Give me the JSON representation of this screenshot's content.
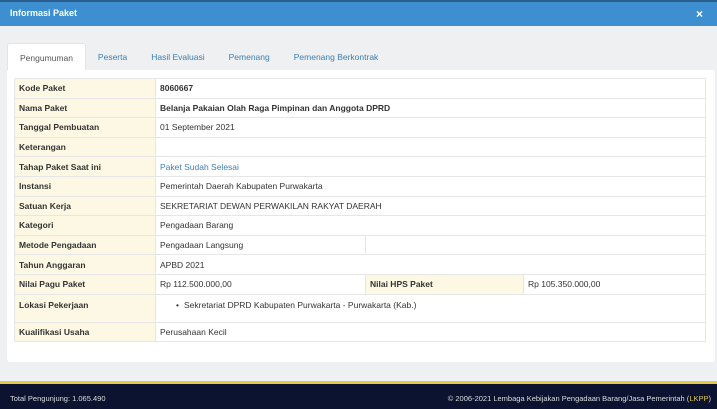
{
  "header": {
    "title": "Informasi Paket",
    "close": "×"
  },
  "tabs": [
    "Pengumuman",
    "Peserta",
    "Hasil Evaluasi",
    "Pemenang",
    "Pemenang Berkontrak"
  ],
  "rows": {
    "kode": {
      "label": "Kode Paket",
      "value": "8060667"
    },
    "nama": {
      "label": "Nama Paket",
      "value": "Belanja Pakaian Olah Raga Pimpinan dan Anggota DPRD"
    },
    "tanggal": {
      "label": "Tanggal Pembuatan",
      "value": "01 September 2021"
    },
    "keterangan": {
      "label": "Keterangan",
      "value": ""
    },
    "tahap": {
      "label": "Tahap Paket Saat ini",
      "value": "Paket Sudah Selesai"
    },
    "instansi": {
      "label": "Instansi",
      "value": "Pemerintah Daerah Kabupaten Purwakarta"
    },
    "satuan": {
      "label": "Satuan Kerja",
      "value": "SEKRETARIAT DEWAN PERWAKILAN RAKYAT DAERAH"
    },
    "kategori": {
      "label": "Kategori",
      "value": "Pengadaan Barang"
    },
    "metode": {
      "label": "Metode Pengadaan",
      "value": "Pengadaan Langsung"
    },
    "tahun": {
      "label": "Tahun Anggaran",
      "value": "APBD 2021"
    },
    "pagu": {
      "label": "Nilai Pagu Paket",
      "value": "Rp 112.500.000,00"
    },
    "hps": {
      "label": "Nilai HPS Paket",
      "value": "Rp 105.350.000,00"
    },
    "lokasi": {
      "label": "Lokasi Pekerjaan",
      "value": "Sekretariat DPRD Kabupaten Purwakarta - Purwakarta (Kab.)"
    },
    "kualifikasi": {
      "label": "Kualifikasi Usaha",
      "value": "Perusahaan Kecil"
    }
  },
  "footer": {
    "visitors": "Total Pengunjung: 1.065.490",
    "copyright": "© 2006-2021 Lembaga Kebijakan Pengadaan Barang/Jasa Pemerintah (",
    "lkpp": "LKPP",
    "close_paren": ")"
  }
}
